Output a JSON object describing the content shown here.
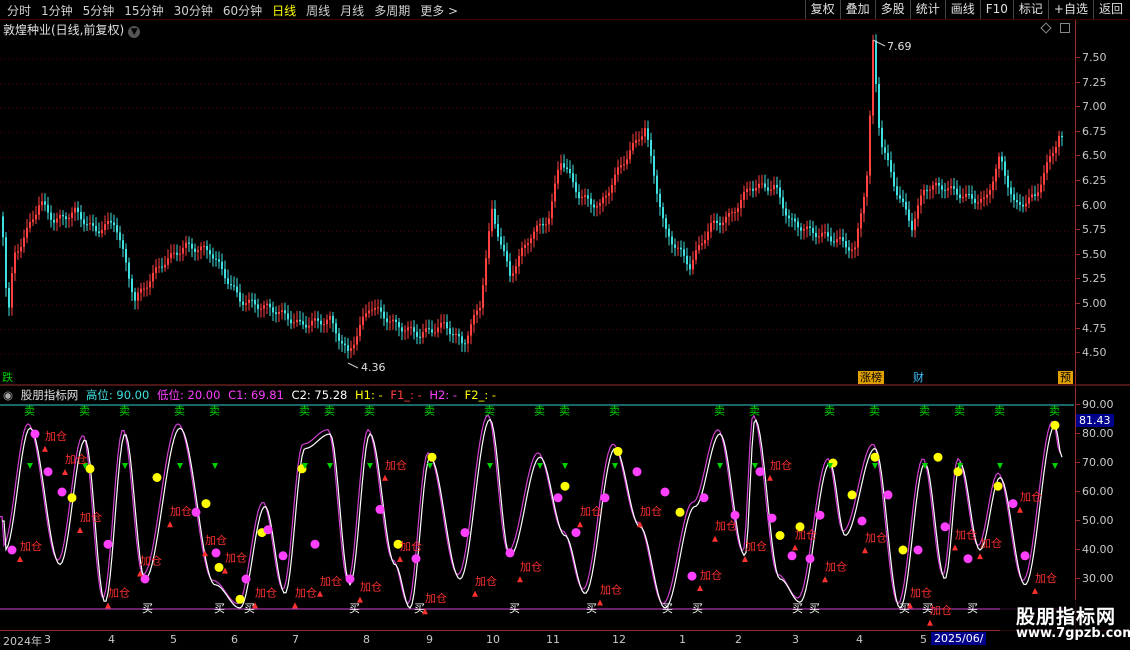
{
  "toolbar": {
    "periods": [
      "分时",
      "1分钟",
      "5分钟",
      "15分钟",
      "30分钟",
      "60分钟",
      "日线",
      "周线",
      "月线",
      "多周期",
      "更多 >"
    ],
    "active_period": "日线",
    "actions": [
      "复权",
      "叠加",
      "多股",
      "统计",
      "画线",
      "F10",
      "标记",
      "+自选",
      "返回"
    ]
  },
  "stock": {
    "title": "敦煌种业(日线,前复权)"
  },
  "main_axis": {
    "ticks": [
      "7.50",
      "7.25",
      "7.00",
      "6.75",
      "6.50",
      "6.25",
      "6.00",
      "5.75",
      "5.50",
      "5.25",
      "5.00",
      "4.75",
      "4.50"
    ]
  },
  "annotations": {
    "high": "7.69",
    "low": "4.36"
  },
  "badges": {
    "left": "跌",
    "hot": "涨榜",
    "fin": "财",
    "pre": "预"
  },
  "indicator": {
    "name": "股朋指标网",
    "high": "高位: 90.00",
    "low": "低位: 20.00",
    "c1": "C1: 69.81",
    "c2": "C2: 75.28",
    "h1": "H1: -",
    "f1": "F1_: -",
    "h2": "H2: -",
    "f2": "F2_: -",
    "current": "81.43",
    "buy_label": "买",
    "sell_label": "卖",
    "add_label": "加仓"
  },
  "osc_axis": {
    "ticks": [
      "90.00",
      "80.00",
      "70.00",
      "60.00",
      "50.00",
      "40.00",
      "30.00"
    ]
  },
  "bottom_axis": {
    "labels": [
      "2024年",
      "3",
      "4",
      "5",
      "6",
      "7",
      "8",
      "9",
      "10",
      "11",
      "12",
      "1",
      "2",
      "3",
      "4",
      "5"
    ],
    "current": "2025/06/"
  },
  "watermark": {
    "line1": "股朋指标网",
    "line2": "www.7gpzb.com"
  },
  "colors": {
    "up": "#ff4040",
    "down": "#40e0e0",
    "buy": "#ffffff",
    "sell": "#00d000",
    "add": "#ff3030",
    "osc_line": "#ffffff",
    "osc_outline": "#d040d0"
  }
}
